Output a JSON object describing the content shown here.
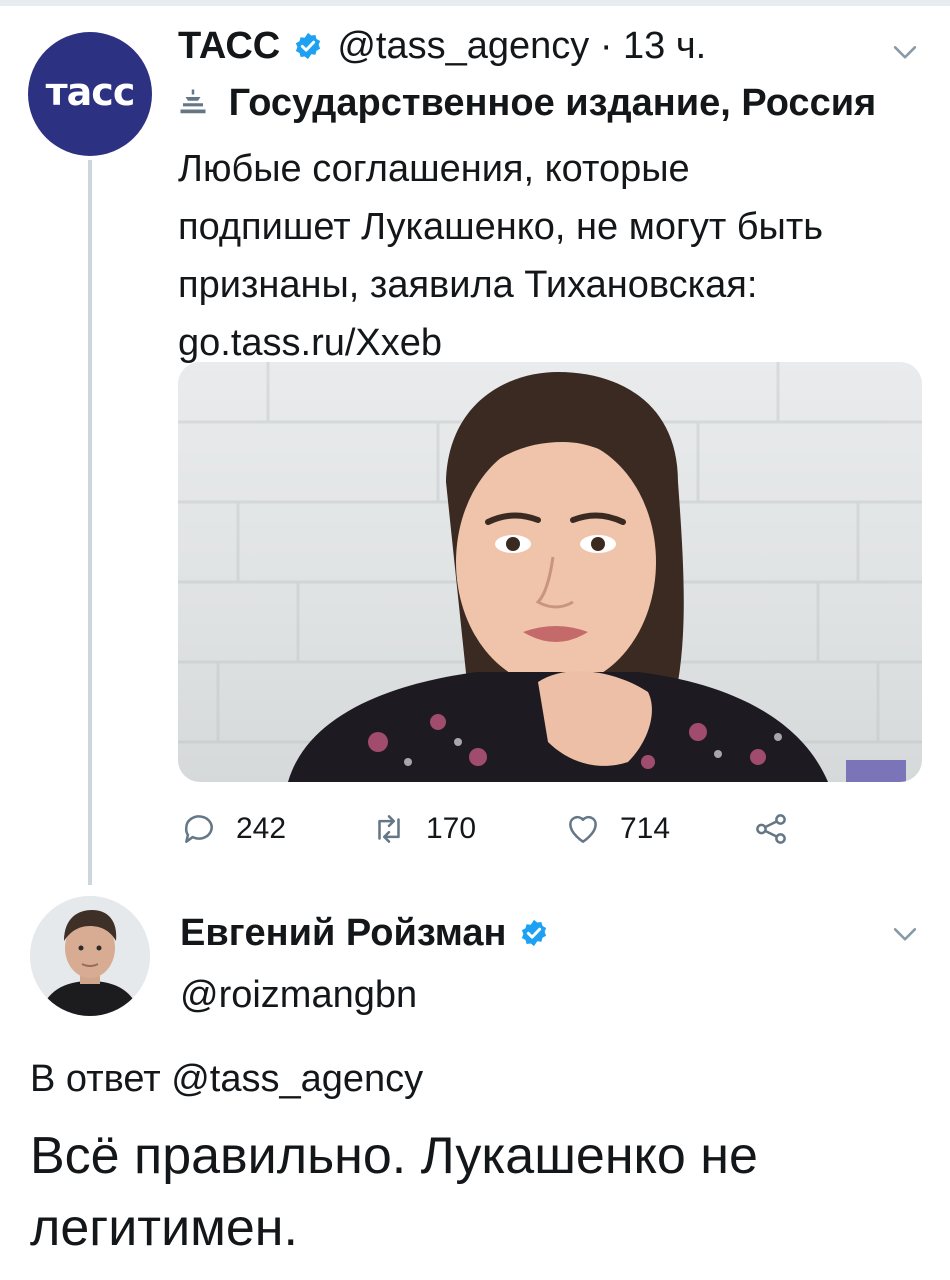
{
  "tweet": {
    "avatar_text": "тасс",
    "author_name": "ТАСС",
    "handle": "@tass_agency",
    "separator": "·",
    "time": "13 ч.",
    "label": "Государственное издание, Россия",
    "text_lines": [
      "Любые соглашения, которые",
      "подпишет Лукашенко, не могут быть",
      "признаны, заявила Тихановская:",
      "go.tass.ru/Xxeb"
    ],
    "stats": {
      "replies": "242",
      "retweets": "170",
      "likes": "714"
    }
  },
  "reply": {
    "author_name": "Евгений Ройзман",
    "handle": "@roizmangbn",
    "in_reply_to": "В ответ @tass_agency",
    "text_lines": [
      "Всё правильно. Лукашенко не",
      "легитимен."
    ]
  },
  "colors": {
    "verified": "#1da1f2",
    "tass_brand": "#2d3182",
    "thread_line": "#ccd6dd",
    "icon_gray": "#657786"
  }
}
